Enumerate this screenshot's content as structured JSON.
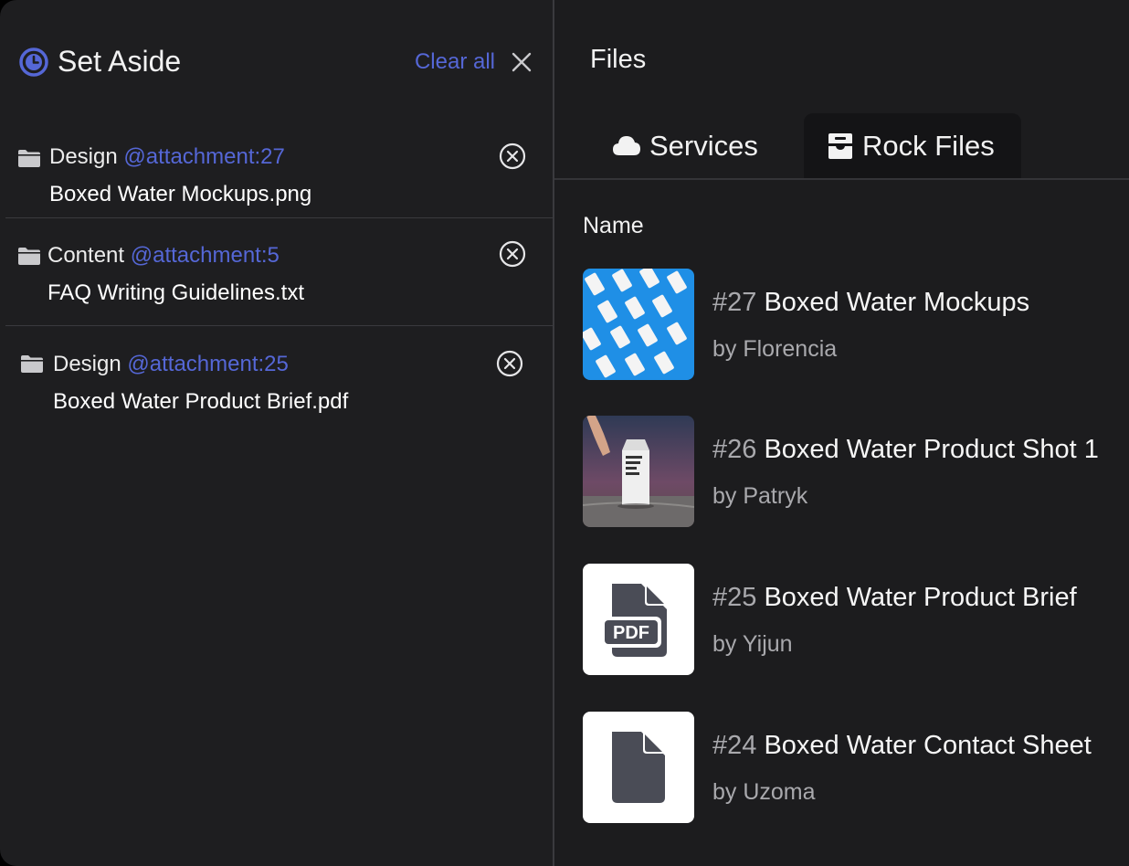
{
  "set_aside": {
    "title": "Set Aside",
    "clear_all_label": "Clear all",
    "items": [
      {
        "category": "Design",
        "ref": "@attachment:27",
        "file": "Boxed Water Mockups.png"
      },
      {
        "category": "Content",
        "ref": "@attachment:5",
        "file": "FAQ Writing Guidelines.txt"
      },
      {
        "category": "Design",
        "ref": "@attachment:25",
        "file": "Boxed Water Product Brief.pdf"
      }
    ]
  },
  "files": {
    "title": "Files",
    "tabs": [
      {
        "label": "Services",
        "icon": "cloud-icon"
      },
      {
        "label": "Rock Files",
        "icon": "inbox-icon",
        "active": true
      }
    ],
    "column_header": "Name",
    "rows": [
      {
        "num": "#27",
        "name": "Boxed Water Mockups",
        "by": "by Florencia",
        "thumb": "image-mockups"
      },
      {
        "num": "#26",
        "name": "Boxed Water Product Shot 1",
        "by": "by Patryk",
        "thumb": "image-product-shot"
      },
      {
        "num": "#25",
        "name": "Boxed Water Product Brief",
        "by": "by Yijun",
        "thumb": "pdf-file-icon"
      },
      {
        "num": "#24",
        "name": "Boxed Water Contact Sheet",
        "by": "by Uzoma",
        "thumb": "file-icon"
      }
    ]
  },
  "colors": {
    "accent": "#5567d6",
    "panel_bg": "#1e1e20",
    "secondary_text": "#a9a9ad",
    "mockup_blue": "#1f8fe6",
    "icon_gray": "#4a4c56"
  }
}
